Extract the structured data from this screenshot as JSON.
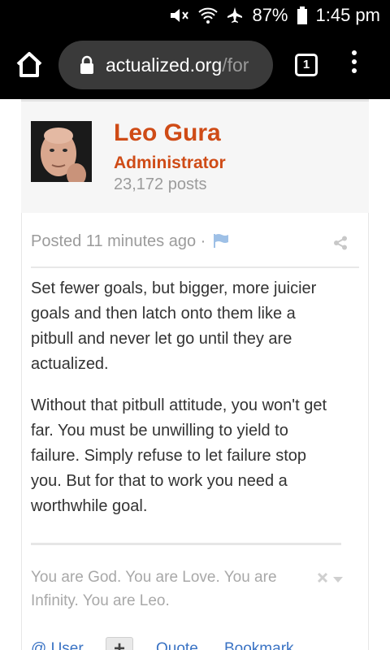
{
  "status": {
    "battery": "87%",
    "time": "1:45 pm"
  },
  "browser": {
    "url_host": "actualized.org",
    "url_path": "/for",
    "tab_count": "1"
  },
  "author": {
    "name": "Leo Gura",
    "role": "Administrator",
    "posts": "23,172 posts"
  },
  "post": {
    "posted": "Posted 11 minutes ago ·",
    "paragraphs": [
      "Set fewer goals, but bigger, more juicier goals and then latch onto them like a pitbull and never let go until they are actualized.",
      "Without that pitbull attitude, you won't get far. You must be unwilling to yield to failure. Simply refuse to let failure stop you. But for that to work you need a worthwhile goal."
    ],
    "signature": "You are God. You are Love. You are Infinity. You are Leo."
  },
  "actions": {
    "user": "@ User",
    "plus": "+",
    "quote": "Quote",
    "bookmark": "Bookmark"
  },
  "colors": {
    "author_accent": "#cf4b16",
    "link": "#3a73c4"
  }
}
